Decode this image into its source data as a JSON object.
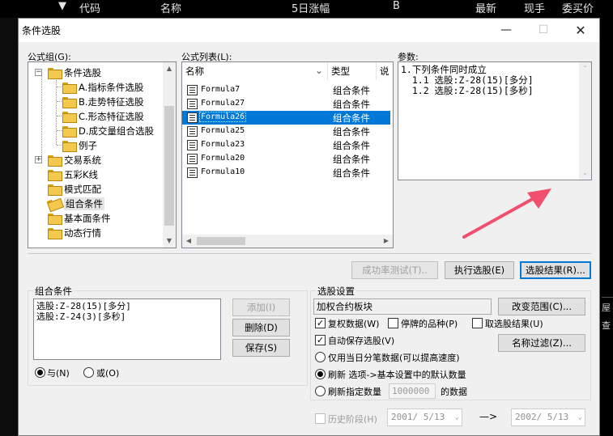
{
  "top_header": {
    "arrow": "▼",
    "code": "代码",
    "name": "名称",
    "change5d": "5日涨幅",
    "b": "B",
    "latest": "最新",
    "hand": "现手",
    "ask": "委买价"
  },
  "right_strip": {
    "t1": "屋",
    "t2": "查"
  },
  "dialog": {
    "title": "条件选股",
    "minimize": "—",
    "maximize": "☐",
    "close": "✕",
    "formula_group_label": "公式组(G):",
    "formula_list_label": "公式列表(L):",
    "params_label": "参数:",
    "tree": [
      {
        "label": "条件选股",
        "expander": "−",
        "icon": "folder-icon"
      },
      {
        "label": "A.指标条件选股",
        "icon": "folder-icon"
      },
      {
        "label": "B.走势特征选股",
        "icon": "folder-icon"
      },
      {
        "label": "C.形态特征选股",
        "icon": "folder-icon"
      },
      {
        "label": "D.成交量组合选股",
        "icon": "folder-icon"
      },
      {
        "label": "例子",
        "icon": "folder-icon"
      },
      {
        "label": "交易系统",
        "expander": "+",
        "icon": "folder-icon"
      },
      {
        "label": "五彩K线",
        "icon": "folder-icon"
      },
      {
        "label": "模式匹配",
        "icon": "folder-icon"
      },
      {
        "label": "组合条件",
        "icon": "tag-icon"
      },
      {
        "label": "基本面条件",
        "icon": "folder-icon"
      },
      {
        "label": "动态行情",
        "icon": "folder-icon"
      }
    ],
    "list_headers": {
      "name": "名称",
      "sort": "⌄",
      "type": "类型",
      "desc": "说"
    },
    "formulas": [
      {
        "name": "Formula7",
        "type": "组合条件"
      },
      {
        "name": "Formula27",
        "type": "组合条件"
      },
      {
        "name": "Formula26",
        "type": "组合条件",
        "selected": true
      },
      {
        "name": "Formula25",
        "type": "组合条件"
      },
      {
        "name": "Formula23",
        "type": "组合条件"
      },
      {
        "name": "Formula20",
        "type": "组合条件"
      },
      {
        "name": "Formula10",
        "type": "组合条件"
      }
    ],
    "params_text": [
      "1.下列条件同时成立",
      "  1.1 选股:Z-28(15)[多分]",
      "  1.2 选股:Z-28(15)[多秒]"
    ],
    "buttons": {
      "success_test": "成功率测试(T)..",
      "run": "执行选股(E)",
      "results": "选股结果(R)..."
    },
    "combo_section": {
      "title": "组合条件",
      "items": [
        "选股:Z-28(15)[多分]",
        "选股:Z-24(3)[多秒]"
      ],
      "add": "添加(I)",
      "delete": "删除(D)",
      "save": "保存(S)",
      "and": "与(N)",
      "or": "或(O)"
    },
    "settings": {
      "title": "选股设置",
      "scope": "加权合约板块",
      "change_scope": "改变范围(C)...",
      "adj_data": "复权数据(W)",
      "suspended": "停牌的品种(P)",
      "cancel_result": "取选股结果(U)",
      "autosave": "自动保存选股(V)",
      "name_filter": "名称过滤(Z)...",
      "only_today": "仅用当日分笔数据(可以提高速度)",
      "refresh_default": "刷新 选项->基本设置中的默认数量",
      "refresh_specified": "刷新指定数量",
      "count_value": "1000000",
      "data_suffix": "的数据",
      "history": "历史阶段(H)",
      "date_from": "2001/ 5/13",
      "arrow": "—>",
      "date_to": "2002/ 5/13",
      "dropdown": "⌄"
    }
  },
  "accent": "#0078d7",
  "annotation_arrow_color": "#f0506e"
}
